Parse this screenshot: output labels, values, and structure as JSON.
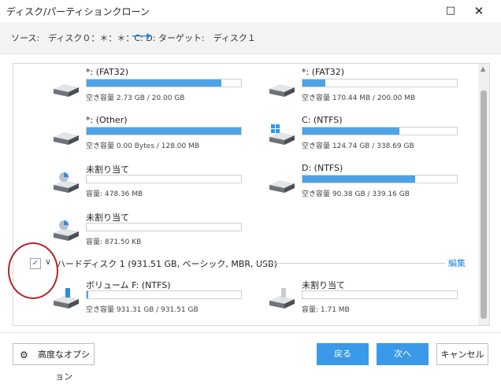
{
  "window": {
    "title": "ディスク/パーティションクローン",
    "maximize_glyph": "□",
    "close_glyph": "✕"
  },
  "path": {
    "source": "ソース:　ディスク０：＊：＊：C: D:",
    "arrow": "⟶",
    "target": "ターゲット:　ディスク１"
  },
  "partitions": [
    {
      "name": "*: (FAT32)",
      "fill_pct": 87,
      "info": "空き容量 2.73 GB / 20.00 GB",
      "icon": "drive-icon"
    },
    {
      "name": "*: (FAT32)",
      "fill_pct": 15,
      "info": "空き容量 170.44 MB / 200.00 MB",
      "icon": "drive-icon"
    },
    {
      "name": "*: (Other)",
      "fill_pct": 100,
      "info": "空き容量 0.00 Bytes / 128.00 MB",
      "icon": "drive-icon"
    },
    {
      "name": "C: (NTFS)",
      "fill_pct": 63,
      "info": "空き容量 124.74 GB / 338.69 GB",
      "icon": "windows-drive-icon"
    },
    {
      "name": "未割り当て",
      "fill_pct": 0,
      "info": "容量: 478.36 MB",
      "icon": "unallocated-drive-icon"
    },
    {
      "name": "D: (NTFS)",
      "fill_pct": 73,
      "info": "空き容量 90.38 GB / 339.16 GB",
      "icon": "drive-icon"
    },
    {
      "name": "未割り当て",
      "fill_pct": 0,
      "info": "容量: 871.50 KB",
      "icon": "unallocated-drive-icon"
    },
    {
      "name": "ボリューム F: (NTFS)",
      "fill_pct": 1,
      "info": "空き容量 931.31 GB / 931.51 GB",
      "icon": "usb-drive-icon"
    },
    {
      "name": "未割り当て",
      "fill_pct": 0,
      "info": "容量: 1.71 MB",
      "icon": "usb-drive-icon"
    }
  ],
  "disk": {
    "label": "ハードディスク 1 (931.51 GB, ベーシック, MBR, USB)",
    "edit": "編集",
    "checked": true,
    "check_glyph": "✓",
    "chevron_glyph": "∨"
  },
  "footer": {
    "advanced_label": "高度なオプション",
    "gear_glyph": "⚙",
    "back_label": "戻る",
    "next_label": "次へ",
    "cancel_label": "キャンセル"
  },
  "colors": {
    "accent": "#3a99e8",
    "bar_fill": "#4da3e8",
    "annotation": "#b3242a"
  }
}
